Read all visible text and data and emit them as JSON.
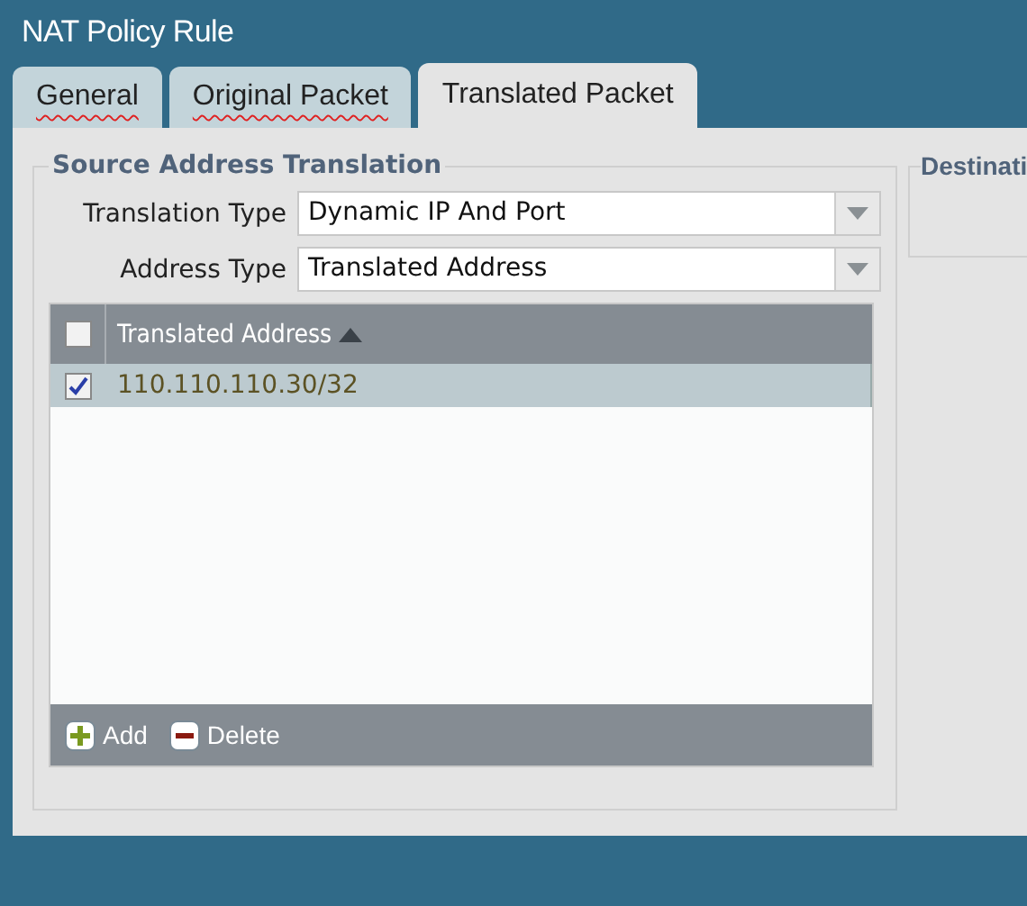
{
  "window": {
    "title": "NAT Policy Rule"
  },
  "tabs": [
    {
      "label": "General",
      "selected": false,
      "misspelled": true
    },
    {
      "label": "Original Packet",
      "selected": false,
      "misspelled": true
    },
    {
      "label": "Translated Packet",
      "selected": true,
      "misspelled": false
    }
  ],
  "source_translation": {
    "legend": "Source Address Translation",
    "fields": [
      {
        "label": "Translation Type",
        "value": "Dynamic IP And Port"
      },
      {
        "label": "Address Type",
        "value": "Translated Address"
      }
    ],
    "table": {
      "columns": [
        {
          "label": "Translated Address",
          "sorted_ascending": true
        }
      ],
      "select_all_checked": false,
      "rows": [
        {
          "cells": [
            "110.110.110.30/32"
          ],
          "checked": true,
          "selected": true
        }
      ]
    },
    "actions": [
      {
        "label": "Add",
        "kind": "add"
      },
      {
        "label": "Delete",
        "kind": "delete"
      }
    ]
  },
  "destination_translation": {
    "legend": "Destinati"
  }
}
